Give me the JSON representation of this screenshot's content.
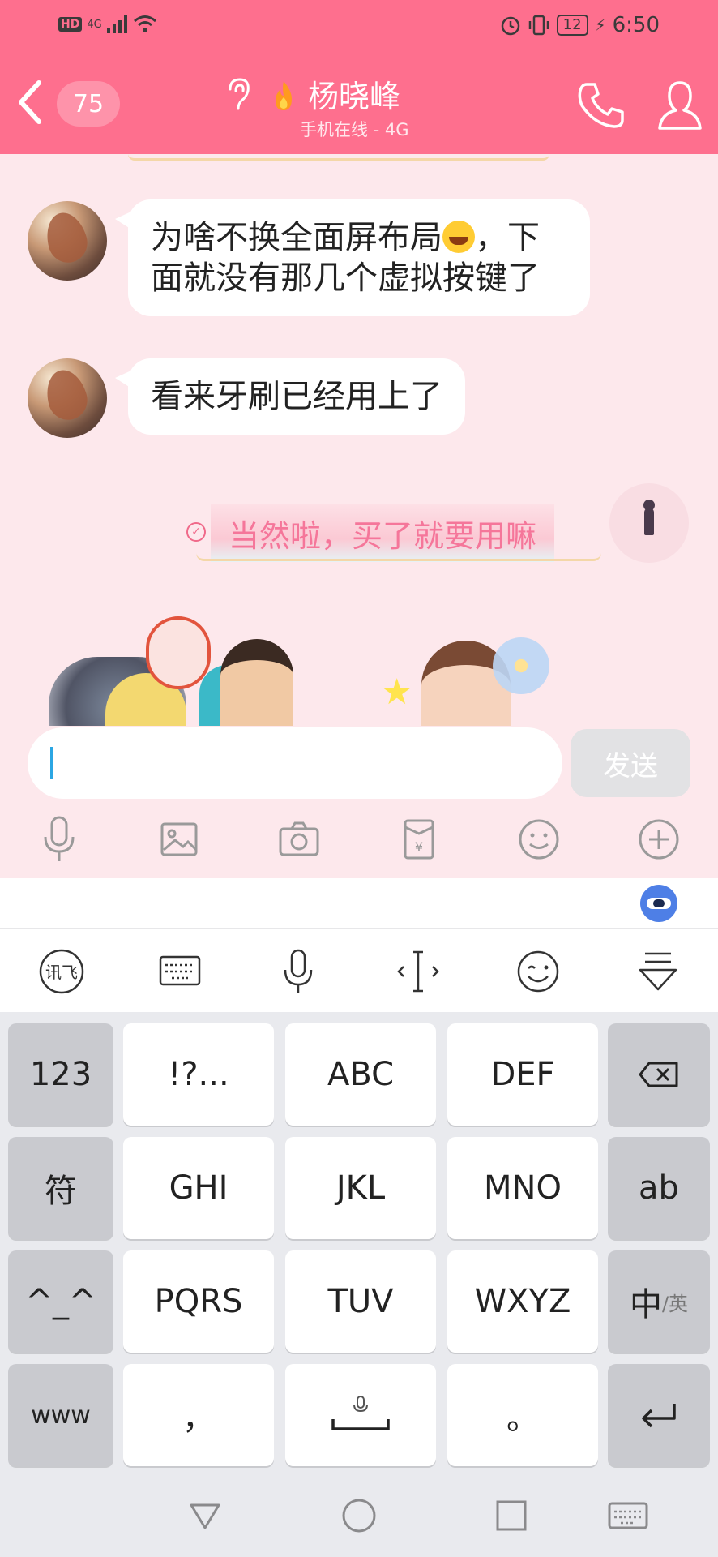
{
  "status_bar": {
    "network": "4G",
    "hd": "HD",
    "battery": "12",
    "time": "6:50"
  },
  "header": {
    "unread_count": "75",
    "contact_name": "杨晓峰",
    "contact_status": "手机在线 - 4G"
  },
  "messages": [
    {
      "from": "contact",
      "text_parts": [
        "为啥不换全面屏布局",
        "，下",
        "面就没有那几个虚拟按键了"
      ]
    },
    {
      "from": "contact",
      "text": "看来牙刷已经用上了"
    },
    {
      "from": "me",
      "text": "当然啦，买了就要用嘛"
    }
  ],
  "input": {
    "value": "",
    "send_label": "发送"
  },
  "keyboard": {
    "rows": [
      [
        "123",
        "!?...",
        "ABC",
        "DEF",
        "⌫"
      ],
      [
        "符",
        "GHI",
        "JKL",
        "MNO",
        "ab"
      ],
      [
        "^_^",
        "PQRS",
        "TUV",
        "WXYZ",
        "中"
      ],
      [
        "www",
        "，",
        "␣",
        "。",
        "↵"
      ]
    ],
    "lang_switch_secondary": "/英"
  },
  "colors": {
    "header": "#fe6f8e",
    "chat_bg": "#fde8ec",
    "sent_text": "#f5769a",
    "keyboard_bg": "#e9eaee"
  }
}
